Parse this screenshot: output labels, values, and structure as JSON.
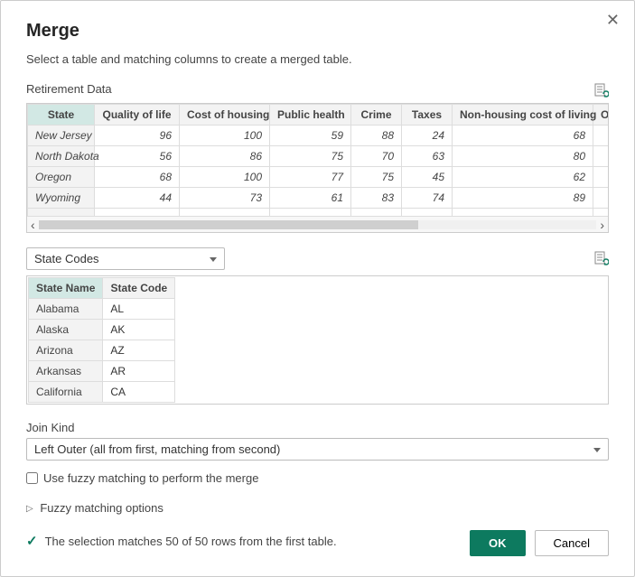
{
  "dialog": {
    "title": "Merge",
    "subtitle": "Select a table and matching columns to create a merged table."
  },
  "topTable": {
    "name": "Retirement Data",
    "columns": [
      "State",
      "Quality of life",
      "Cost of housing",
      "Public health",
      "Crime",
      "Taxes",
      "Non-housing cost of living",
      "Ov"
    ],
    "rows": [
      {
        "state": "New Jersey",
        "qol": 96,
        "housing": 100,
        "health": 59,
        "crime": 88,
        "taxes": 24,
        "nonhousing": 68
      },
      {
        "state": "North Dakota",
        "qol": 56,
        "housing": 86,
        "health": 75,
        "crime": 70,
        "taxes": 63,
        "nonhousing": 80
      },
      {
        "state": "Oregon",
        "qol": 68,
        "housing": 100,
        "health": 77,
        "crime": 75,
        "taxes": 45,
        "nonhousing": 62
      },
      {
        "state": "Wyoming",
        "qol": 44,
        "housing": 73,
        "health": 61,
        "crime": 83,
        "taxes": 74,
        "nonhousing": 89
      }
    ]
  },
  "bottomDropdown": {
    "selected": "State Codes"
  },
  "bottomTable": {
    "columns": [
      "State Name",
      "State Code"
    ],
    "rows": [
      {
        "name": "Alabama",
        "code": "AL"
      },
      {
        "name": "Alaska",
        "code": "AK"
      },
      {
        "name": "Arizona",
        "code": "AZ"
      },
      {
        "name": "Arkansas",
        "code": "AR"
      },
      {
        "name": "California",
        "code": "CA"
      }
    ]
  },
  "joinKind": {
    "label": "Join Kind",
    "selected": "Left Outer (all from first, matching from second)"
  },
  "fuzzy": {
    "checkboxLabel": "Use fuzzy matching to perform the merge",
    "expanderLabel": "Fuzzy matching options"
  },
  "status": {
    "message": "The selection matches 50 of 50 rows from the first table."
  },
  "buttons": {
    "ok": "OK",
    "cancel": "Cancel"
  }
}
